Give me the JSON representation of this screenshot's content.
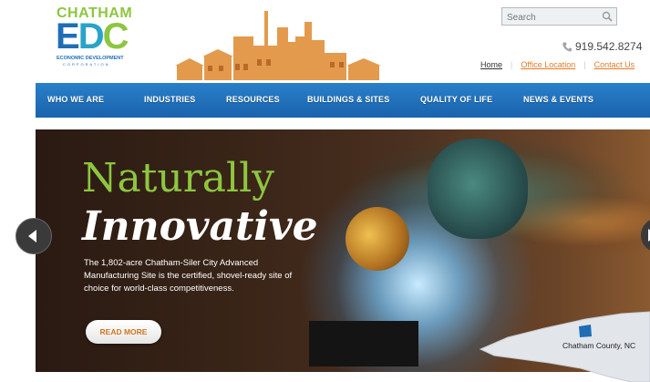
{
  "brand": {
    "top": "CHATHAM",
    "mark_e": "E",
    "mark_d": "D",
    "mark_c": "C",
    "sub": "ECONOMIC DEVELOPMENT",
    "sub2": "CORPORATION",
    "green": "#8dc63f",
    "blue": "#1f6eb5",
    "teal": "#2aa3c8"
  },
  "search": {
    "placeholder": "Search",
    "icon": "search-icon"
  },
  "phone": {
    "number": "919.542.8274",
    "icon": "phone-icon"
  },
  "utility_nav": {
    "home": "Home",
    "office": "Office Location",
    "contact": "Contact Us",
    "accent": "#e07b27"
  },
  "nav": {
    "items": [
      "WHO WE ARE",
      "INDUSTRIES",
      "RESOURCES",
      "BUILDINGS & SITES",
      "QUALITY OF LIFE",
      "NEWS & EVENTS"
    ],
    "background": "#1f6eb5"
  },
  "hero": {
    "headline1": "Naturally",
    "headline2": "Innovative",
    "description": "The 1,802-acre Chatham-Siler City Advanced Manufacturing Site is the certified, shovel-ready site of choice for world-class competitiveness.",
    "button": "READ MORE",
    "map_label": "Chatham County, NC",
    "prev_icon": "arrow-left-icon",
    "next_icon": "arrow-right-icon"
  }
}
